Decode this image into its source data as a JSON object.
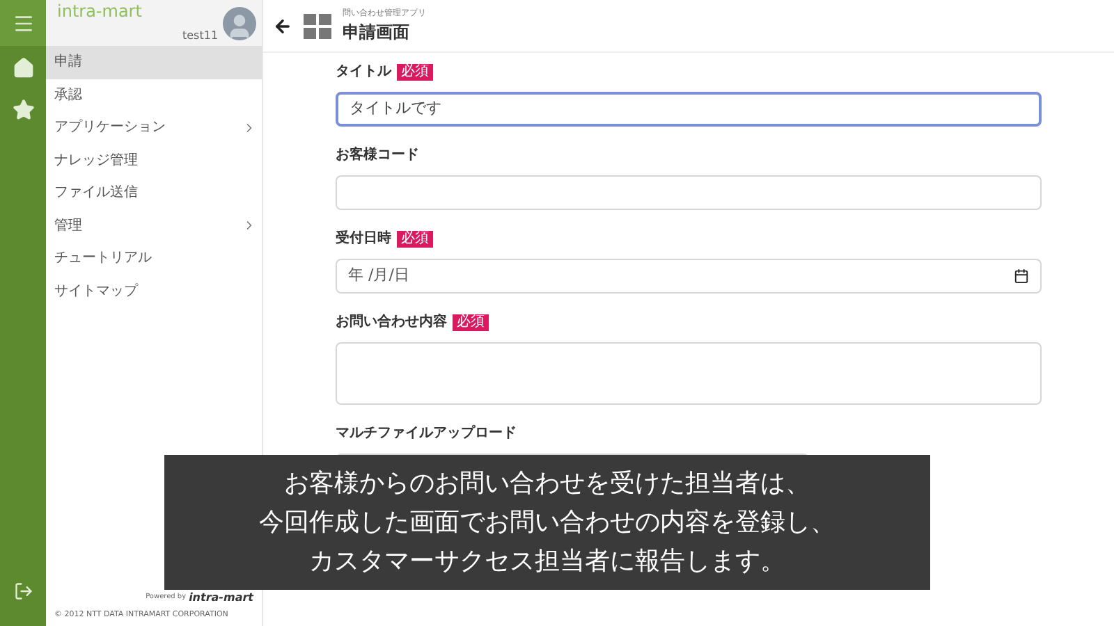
{
  "brand": {
    "logo": "intra-mart",
    "user": "test11"
  },
  "sidebar": {
    "items": [
      {
        "label": "申請",
        "selected": true,
        "expandable": false
      },
      {
        "label": "承認",
        "selected": false,
        "expandable": false
      },
      {
        "label": "アプリケーション",
        "selected": false,
        "expandable": true
      },
      {
        "label": "ナレッジ管理",
        "selected": false,
        "expandable": false
      },
      {
        "label": "ファイル送信",
        "selected": false,
        "expandable": false
      },
      {
        "label": "管理",
        "selected": false,
        "expandable": true
      },
      {
        "label": "チュートリアル",
        "selected": false,
        "expandable": false
      },
      {
        "label": "サイトマップ",
        "selected": false,
        "expandable": false
      }
    ],
    "footer": {
      "powered_by": "Powered by",
      "brand": "intra-mart",
      "copyright": "© 2012 NTT DATA INTRAMART CORPORATION"
    }
  },
  "header": {
    "app_name": "問い合わせ管理アプリ",
    "page_title": "申請画面"
  },
  "form": {
    "fields": [
      {
        "kind": "text",
        "label": "タイトル",
        "badge": "必須",
        "value": "タイトルです",
        "focused": true
      },
      {
        "kind": "text",
        "label": "お客様コード",
        "focused": false
      },
      {
        "kind": "date",
        "label": "受付日時",
        "badge": "必須",
        "placeholder": "年 /月/日",
        "focused": false
      },
      {
        "kind": "textarea",
        "label": "お問い合わせ内容",
        "badge": "必須",
        "focused": false
      },
      {
        "kind": "upload",
        "label": "マルチファイルアップロード"
      }
    ]
  },
  "caption": {
    "lines": [
      "お客様からのお問い合わせを受けた担当者は、",
      "今回作成した画面でお問い合わせの内容を登録し、",
      "カスタマーサクセス担当者に報告します。"
    ]
  }
}
